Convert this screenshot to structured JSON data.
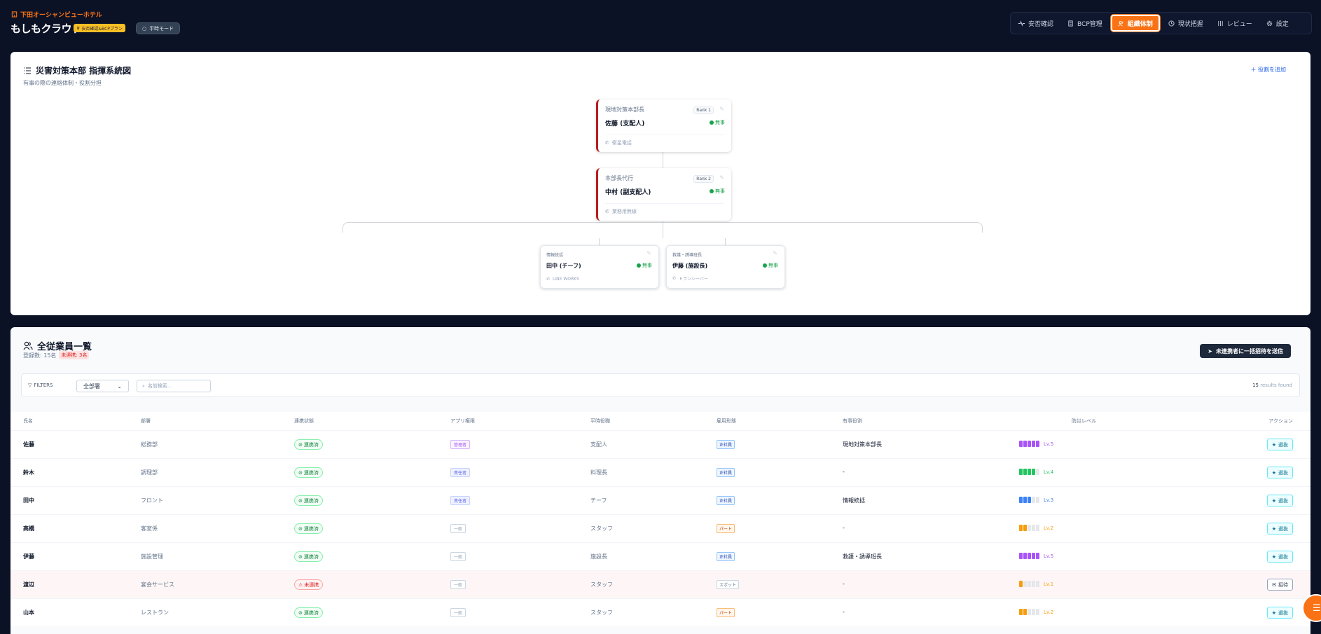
{
  "header": {
    "hotel_name": "下田オーシャンビューホテル",
    "app_name": "もしもクラウド",
    "plan_badge": "安否確認&BCPプラン",
    "mode_label": "平時モード"
  },
  "nav": {
    "items": [
      {
        "label": "安否確認",
        "icon": "pulse-icon",
        "active": false
      },
      {
        "label": "BCP管理",
        "icon": "document-icon",
        "active": false
      },
      {
        "label": "組織体制",
        "icon": "users-icon",
        "active": true
      },
      {
        "label": "現状把握",
        "icon": "clock-icon",
        "active": false
      },
      {
        "label": "レビュー",
        "icon": "sliders-icon",
        "active": false
      },
      {
        "label": "設定",
        "icon": "gear-icon",
        "active": false
      }
    ]
  },
  "org_chart": {
    "title": "災害対策本部 指揮系統図",
    "subtitle": "有事の際の連絡体制・役割分担",
    "add_role_label": "役割を追加",
    "nodes": [
      {
        "role": "現地対策本部長",
        "rank": "Rank 1",
        "name": "佐藤 (支配人)",
        "status": "無事",
        "contact": "衛星電話"
      },
      {
        "role": "本部長代行",
        "rank": "Rank 2",
        "name": "中村 (副支配人)",
        "status": "無事",
        "contact": "業務用無線"
      },
      {
        "role": "情報統括",
        "name": "田中 (チーフ)",
        "status": "無事",
        "contact": "LINE WORKS"
      },
      {
        "role": "救護・誘導班長",
        "name": "伊藤 (施設長)",
        "status": "無事",
        "contact": "トランシーバー"
      }
    ]
  },
  "employees": {
    "title": "全従業員一覧",
    "registered_count": "登録数: 15名",
    "unlinked_count": "未連携: 3名",
    "bulk_invite_label": "未連携者に一括招待を送信",
    "filters_label": "FILTERS",
    "dept_filter_value": "全部署",
    "search_placeholder": "名前検索...",
    "results_count": "15",
    "results_suffix": "results found",
    "columns": [
      "氏名",
      "部署",
      "連携状態",
      "アプリ権限",
      "平時役職",
      "雇用形態",
      "有事役割",
      "防災レベル",
      "アクション"
    ],
    "rows": [
      {
        "name": "佐藤",
        "dept": "総務部",
        "link": "連携済",
        "linked": true,
        "perm": "管理者",
        "perm_type": "admin",
        "position": "支配人",
        "employment": "正社員",
        "emp_type": "full",
        "crisis_role": "現地対策本部長",
        "level": 5,
        "level_label": "Lv.5",
        "level_color": "#a855f7",
        "action": "選抜",
        "action_type": "select"
      },
      {
        "name": "鈴木",
        "dept": "調理部",
        "link": "連携済",
        "linked": true,
        "perm": "責任者",
        "perm_type": "mgr",
        "position": "料理長",
        "employment": "正社員",
        "emp_type": "full",
        "crisis_role": "-",
        "level": 4,
        "level_label": "Lv.4",
        "level_color": "#22c55e",
        "action": "選抜",
        "action_type": "select"
      },
      {
        "name": "田中",
        "dept": "フロント",
        "link": "連携済",
        "linked": true,
        "perm": "責任者",
        "perm_type": "mgr",
        "position": "チーフ",
        "employment": "正社員",
        "emp_type": "full",
        "crisis_role": "情報統括",
        "level": 3,
        "level_label": "Lv.3",
        "level_color": "#3b82f6",
        "action": "選抜",
        "action_type": "select"
      },
      {
        "name": "高橋",
        "dept": "客室係",
        "link": "連携済",
        "linked": true,
        "perm": "一般",
        "perm_type": "gen",
        "position": "スタッフ",
        "employment": "パート",
        "emp_type": "part",
        "crisis_role": "-",
        "level": 2,
        "level_label": "Lv.2",
        "level_color": "#f59e0b",
        "action": "選抜",
        "action_type": "select"
      },
      {
        "name": "伊藤",
        "dept": "施設管理",
        "link": "連携済",
        "linked": true,
        "perm": "一般",
        "perm_type": "gen",
        "position": "施設長",
        "employment": "正社員",
        "emp_type": "full",
        "crisis_role": "救護・誘導班長",
        "level": 5,
        "level_label": "Lv.5",
        "level_color": "#a855f7",
        "action": "選抜",
        "action_type": "select"
      },
      {
        "name": "渡辺",
        "dept": "宴会サービス",
        "link": "未連携",
        "linked": false,
        "perm": "一般",
        "perm_type": "gen",
        "position": "スタッフ",
        "employment": "スポット",
        "emp_type": "spot",
        "crisis_role": "-",
        "level": 1,
        "level_label": "Lv.1",
        "level_color": "#f59e0b",
        "action": "招待",
        "action_type": "invite"
      },
      {
        "name": "山本",
        "dept": "レストラン",
        "link": "連携済",
        "linked": true,
        "perm": "一般",
        "perm_type": "gen",
        "position": "スタッフ",
        "employment": "パート",
        "emp_type": "part",
        "crisis_role": "-",
        "level": 2,
        "level_label": "Lv.2",
        "level_color": "#f59e0b",
        "action": "選抜",
        "action_type": "select"
      }
    ]
  },
  "colors": {
    "accent": "#f97316",
    "background": "#0b1226",
    "safe": "#16a34a",
    "alert": "#dc2626"
  }
}
